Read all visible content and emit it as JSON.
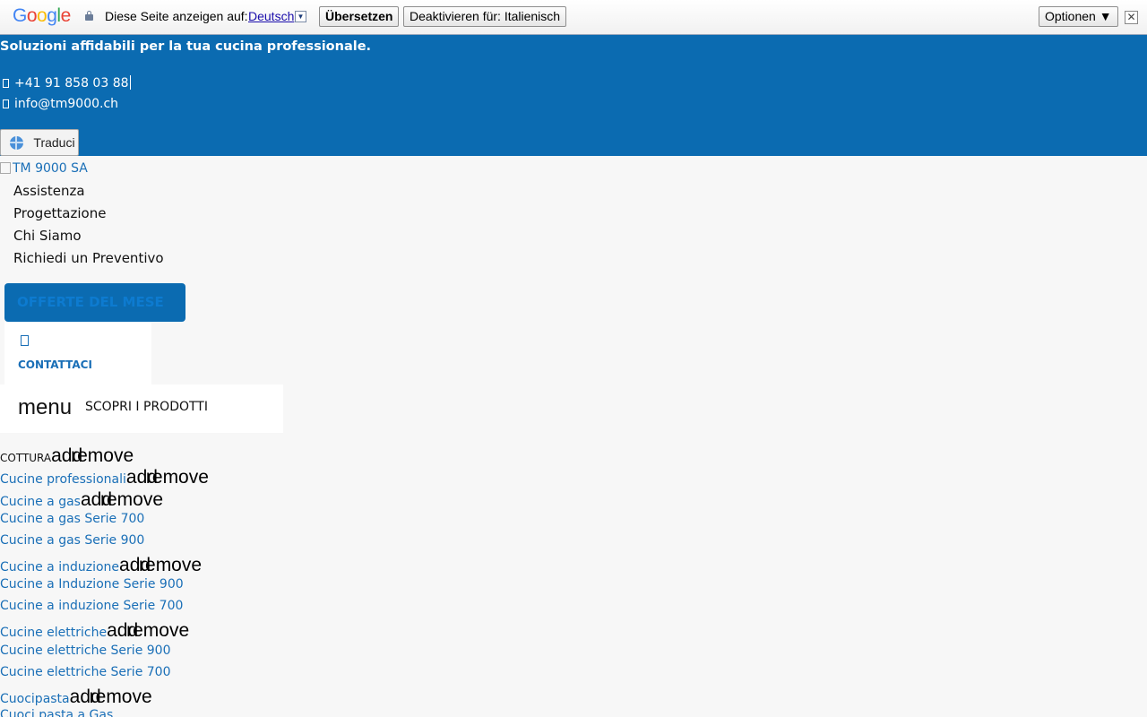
{
  "translate_bar": {
    "logo_text": "Google",
    "logo_colors": [
      "#4285f4",
      "#ea4335",
      "#fbbc05",
      "#4285f4",
      "#34a853",
      "#ea4335"
    ],
    "label": "Diese Seite anzeigen auf:",
    "language": "Deutsch",
    "translate_button": "Übersetzen",
    "disable_button": "Deaktivieren für: Italienisch",
    "options_button": "Optionen ▼",
    "close_symbol": "✕"
  },
  "topbar": {
    "tagline": "Soluzioni affidabili per la tua cucina professionale.",
    "phone": "+41 91 858 03 88",
    "email": "info@tm9000.ch",
    "translate_button": "Traduci",
    "background_color": "#0b6bb1"
  },
  "logo_alt": "TM 9000 SA",
  "nav": [
    "Assistenza",
    "Progettazione",
    "Chi Siamo",
    "Richiedi un Preventivo"
  ],
  "offerte_button": "OFFERTE DEL MESE",
  "contattaci_label": "CONTATTACI",
  "menu_label": "menu",
  "scopri_label": "SCOPRI I PRODOTTI",
  "toggle": {
    "add": "add",
    "remove": "remove"
  },
  "categories": [
    {
      "label": "COTTURA",
      "head": true,
      "toggle": true
    },
    {
      "label": "Cucine professionali",
      "toggle": true
    },
    {
      "label": "Cucine a gas",
      "toggle": true
    },
    {
      "label": "Cucine a gas Serie 700",
      "toggle": false
    },
    {
      "label": "Cucine a gas Serie 900",
      "toggle": false
    },
    {
      "label": "Cucine a induzione",
      "toggle": true
    },
    {
      "label": "Cucine a Induzione Serie 900",
      "toggle": false
    },
    {
      "label": "Cucine a induzione Serie 700",
      "toggle": false
    },
    {
      "label": "Cucine elettriche",
      "toggle": true
    },
    {
      "label": "Cucine elettriche Serie 900",
      "toggle": false
    },
    {
      "label": "Cucine elettriche Serie 700",
      "toggle": false
    },
    {
      "label": "Cuocipasta",
      "toggle": true
    },
    {
      "label": "Cuoci pasta a Gas",
      "toggle": false
    }
  ]
}
